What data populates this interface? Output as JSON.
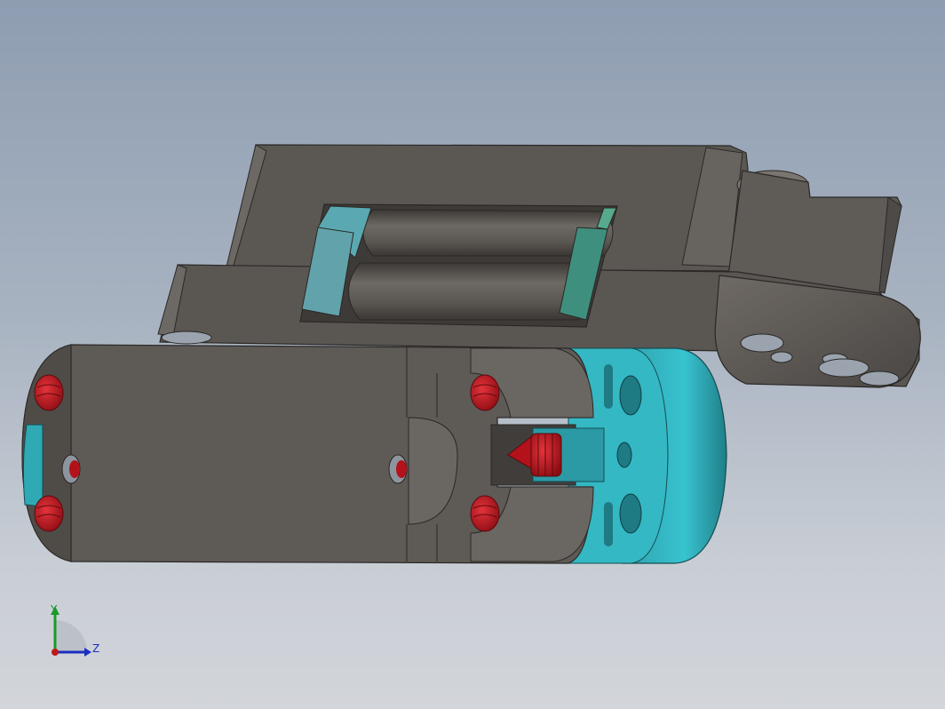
{
  "viewport": {
    "background_top": "#8e9db1",
    "background_bottom": "#d2d5da"
  },
  "model": {
    "body_color": "#5f5b57",
    "body_dark": "#4a4744",
    "body_light": "#6e6a65",
    "teal_color": "#2fa9b4",
    "teal_light": "#3ed0de",
    "green_color": "#3f8f7e",
    "red_color": "#b3121a"
  },
  "triad": {
    "y_label": "Y",
    "z_label": "Z",
    "y_color": "#1a9a2a",
    "z_color": "#1a2ec0",
    "x_color": "#c01818"
  }
}
